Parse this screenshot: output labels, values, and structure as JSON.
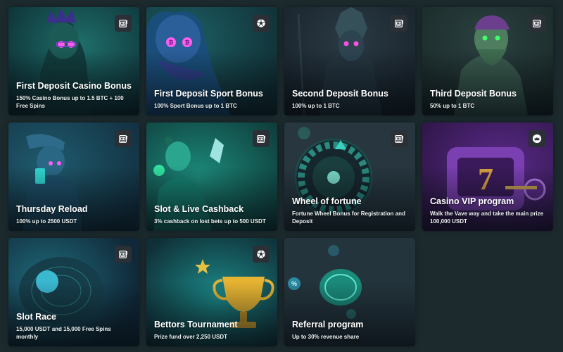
{
  "cards": [
    {
      "title": "First Deposit Casino Bonus",
      "desc": "150% Casino Bonus up to 1.5 BTC + 100 Free Spins",
      "icon": "slot-machine-icon"
    },
    {
      "title": "First Deposit Sport Bonus",
      "desc": "100% Sport Bonus up to 1 BTC",
      "icon": "soccer-ball-icon"
    },
    {
      "title": "Second Deposit Bonus",
      "desc": "100% up to 1 BTC",
      "icon": "slot-machine-icon"
    },
    {
      "title": "Third Deposit Bonus",
      "desc": "50% up to 1 BTC",
      "icon": "slot-machine-icon"
    },
    {
      "title": "Thursday Reload",
      "desc": "100% up to 2500 USDT",
      "icon": "slot-machine-icon"
    },
    {
      "title": "Slot & Live Cashback",
      "desc": "3% cashback on lost bets up to 500 USDT",
      "icon": "slot-machine-icon"
    },
    {
      "title": "Wheel of fortune",
      "desc": "Fortune Wheel Bonus for Registration and Deposit",
      "icon": "slot-machine-icon"
    },
    {
      "title": "Casino VIP program",
      "desc": "Walk the Vave way and take the main prize 100,000 USDT",
      "icon": "crown-icon"
    },
    {
      "title": "Slot Race",
      "desc": "15,000 USDT and 15,000 Free Spins monthly",
      "icon": "slot-machine-icon"
    },
    {
      "title": "Bettors Tournament",
      "desc": "Prize fund over 2,250 USDT",
      "icon": "soccer-ball-icon"
    },
    {
      "title": "Referral program",
      "desc": "Up to 30% revenue share",
      "icon": ""
    }
  ]
}
